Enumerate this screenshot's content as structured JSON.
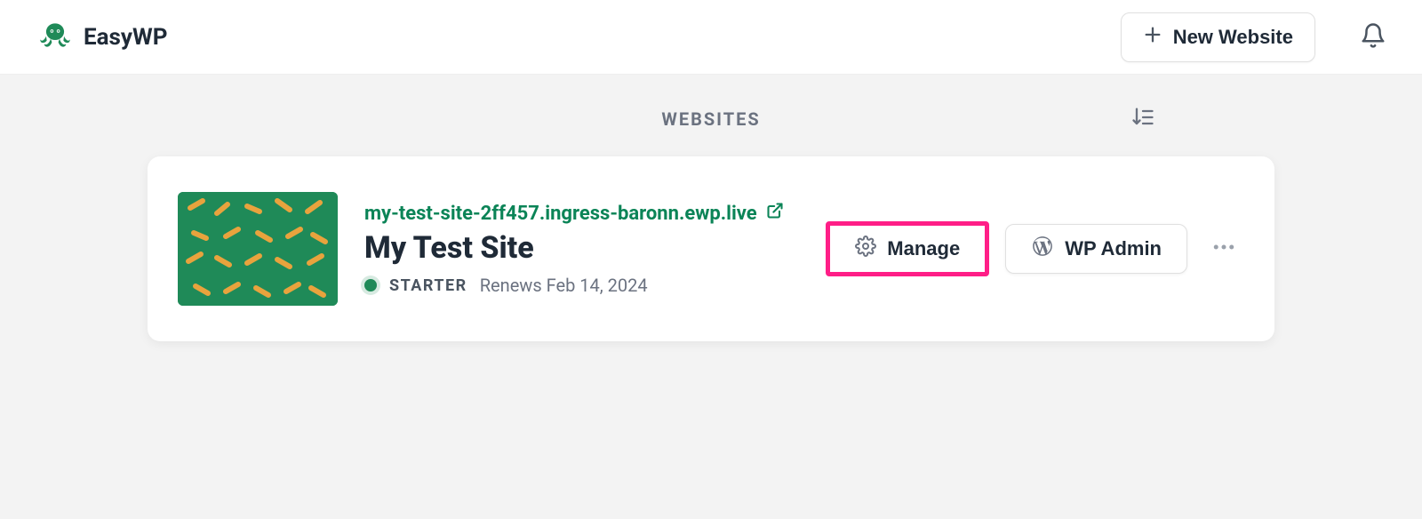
{
  "header": {
    "brand": "EasyWP",
    "new_website_label": "New Website"
  },
  "section": {
    "title": "WEBSITES"
  },
  "site": {
    "url": "my-test-site-2ff457.ingress-baronn.ewp.live",
    "name": "My Test Site",
    "plan": "STARTER",
    "renew_text": "Renews Feb 14, 2024",
    "manage_label": "Manage",
    "wpadmin_label": "WP Admin"
  }
}
